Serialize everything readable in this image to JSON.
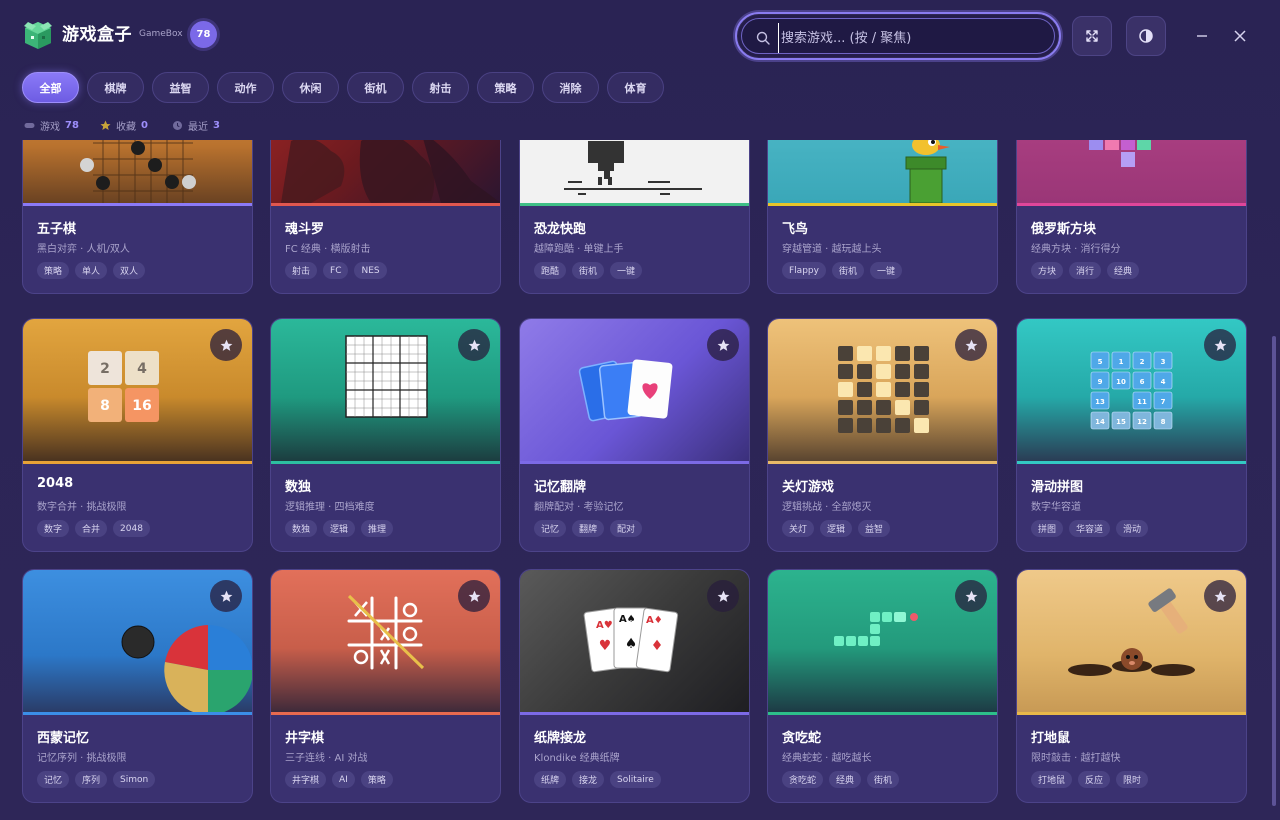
{
  "header": {
    "title": "游戏盒子",
    "subtitle": "GameBox",
    "count_badge": "78"
  },
  "search": {
    "placeholder": "搜索游戏... (按 / 聚焦)"
  },
  "tabs": [
    {
      "label": "全部",
      "active": true
    },
    {
      "label": "棋牌"
    },
    {
      "label": "益智"
    },
    {
      "label": "动作"
    },
    {
      "label": "休闲"
    },
    {
      "label": "街机"
    },
    {
      "label": "射击"
    },
    {
      "label": "策略"
    },
    {
      "label": "消除"
    },
    {
      "label": "体育"
    }
  ],
  "stats": {
    "games_label": "游戏",
    "games_count": "78",
    "favorites_label": "收藏",
    "favorites_count": "0",
    "recent_label": "最近",
    "recent_count": "3"
  },
  "cards": [
    {
      "name": "五子棋",
      "desc": "黑白对弈 · 人机/双人",
      "tags": [
        "策略",
        "单人",
        "双人"
      ],
      "stripe": "#8b7af7",
      "icon": "gomoku-board"
    },
    {
      "name": "魂斗罗",
      "desc": "FC 经典 · 横版射击",
      "tags": [
        "射击",
        "FC",
        "NES"
      ],
      "stripe": "#e0574f",
      "icon": "contra-art"
    },
    {
      "name": "恐龙快跑",
      "desc": "越障跑酷 · 单键上手",
      "tags": [
        "跑酷",
        "街机",
        "一键"
      ],
      "stripe": "#3fbf86",
      "icon": "dino-sprite"
    },
    {
      "name": "飞鸟",
      "desc": "穿越管道 · 越玩越上头",
      "tags": [
        "Flappy",
        "街机",
        "一键"
      ],
      "stripe": "#e8c42a",
      "icon": "flappy-bird"
    },
    {
      "name": "俄罗斯方块",
      "desc": "经典方块 · 消行得分",
      "tags": [
        "方块",
        "消行",
        "经典"
      ],
      "stripe": "#e0469a",
      "icon": "tetris-blocks"
    },
    {
      "name": "2048",
      "desc": "数字合并 · 挑战极限",
      "tags": [
        "数字",
        "合并",
        "2048"
      ],
      "stripe": "#e8a236",
      "icon": "2048-tiles",
      "tiles": [
        "2",
        "4",
        "8",
        "16"
      ]
    },
    {
      "name": "数独",
      "desc": "逻辑推理 · 四档难度",
      "tags": [
        "数独",
        "逻辑",
        "推理"
      ],
      "stripe": "#2dbfa0",
      "icon": "sudoku-grid"
    },
    {
      "name": "记忆翻牌",
      "desc": "翻牌配对 · 考验记忆",
      "tags": [
        "记忆",
        "翻牌",
        "配对"
      ],
      "stripe": "#7c6ae6",
      "icon": "memory-cards"
    },
    {
      "name": "关灯游戏",
      "desc": "逻辑挑战 · 全部熄灭",
      "tags": [
        "关灯",
        "逻辑",
        "益智"
      ],
      "stripe": "#e8b968",
      "icon": "lights-grid"
    },
    {
      "name": "滑动拼图",
      "desc": "数字华容道",
      "tags": [
        "拼图",
        "华容道",
        "滑动"
      ],
      "stripe": "#33c9c3",
      "icon": "slide-puzzle",
      "tiles": [
        "5",
        "1",
        "2",
        "3",
        "9",
        "10",
        "6",
        "4",
        "13",
        "",
        "11",
        "7",
        "14",
        "15",
        "12",
        "8"
      ]
    },
    {
      "name": "西蒙记忆",
      "desc": "记忆序列 · 挑战极限",
      "tags": [
        "记忆",
        "序列",
        "Simon"
      ],
      "stripe": "#3b8ee8",
      "icon": "simon-wheel"
    },
    {
      "name": "井字棋",
      "desc": "三子连线 · AI 对战",
      "tags": [
        "井字棋",
        "AI",
        "策略"
      ],
      "stripe": "#e86a4f",
      "icon": "tictactoe-board"
    },
    {
      "name": "纸牌接龙",
      "desc": "Klondike 经典纸牌",
      "tags": [
        "纸牌",
        "接龙",
        "Solitaire"
      ],
      "stripe": "#7c6ae6",
      "icon": "playing-cards",
      "cards": [
        "A♥",
        "A♠",
        "A♦"
      ]
    },
    {
      "name": "贪吃蛇",
      "desc": "经典蛇蛇 · 越吃越长",
      "tags": [
        "贪吃蛇",
        "经典",
        "街机"
      ],
      "stripe": "#2dbf8a",
      "icon": "snake-sprite"
    },
    {
      "name": "打地鼠",
      "desc": "限时敲击 · 越打越快",
      "tags": [
        "打地鼠",
        "反应",
        "限时"
      ],
      "stripe": "#e8b84a",
      "icon": "whack-mole"
    }
  ]
}
